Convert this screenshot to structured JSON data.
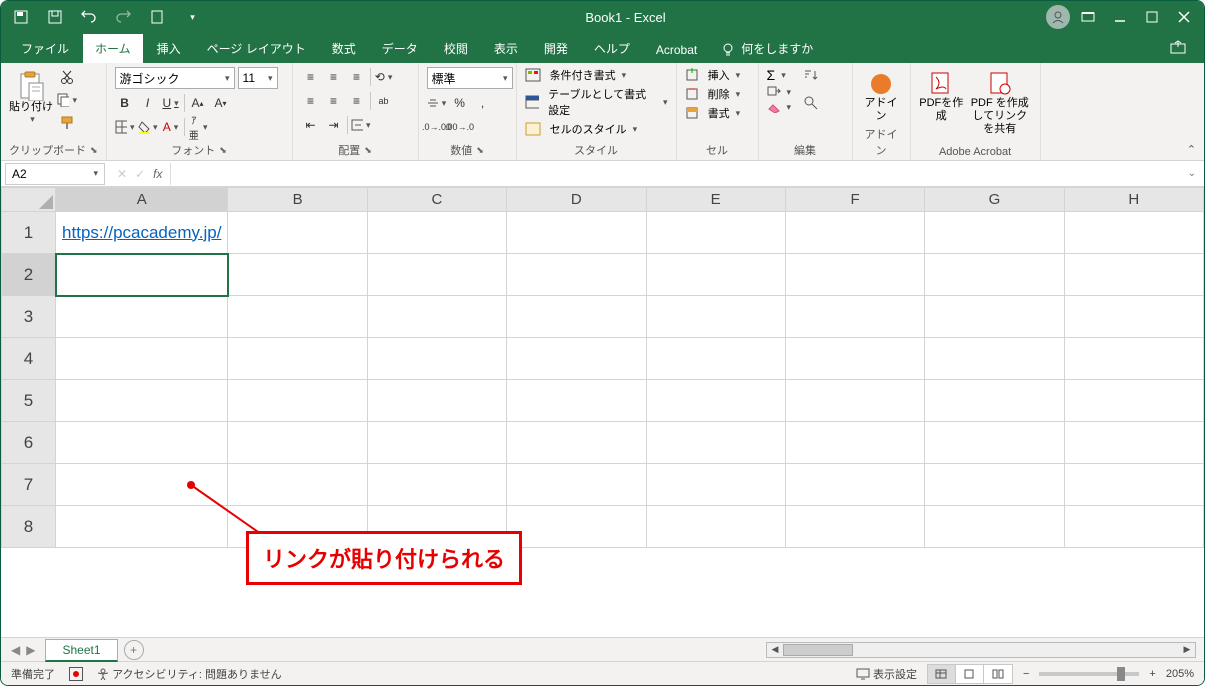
{
  "app": {
    "title": "Book1  -  Excel",
    "app_name": "Excel"
  },
  "qat": {
    "save": "floppy",
    "undo": "undo",
    "redo": "redo",
    "touch": "touch"
  },
  "tabs": {
    "file": "ファイル",
    "home": "ホーム",
    "insert": "挿入",
    "page_layout": "ページ レイアウト",
    "formulas": "数式",
    "data": "データ",
    "review": "校閲",
    "view": "表示",
    "developer": "開発",
    "help": "ヘルプ",
    "acrobat": "Acrobat",
    "tell_me": "何をしますか"
  },
  "ribbon": {
    "clipboard": {
      "label": "クリップボード",
      "paste": "貼り付け"
    },
    "font": {
      "label": "フォント",
      "name": "游ゴシック",
      "size": "11",
      "bold": "B",
      "italic": "I",
      "underline": "U"
    },
    "alignment": {
      "label": "配置",
      "wrap": "ab"
    },
    "number": {
      "label": "数値",
      "format": "標準",
      "percent": "%",
      "comma": ","
    },
    "styles": {
      "label": "スタイル",
      "cond": "条件付き書式",
      "table_fmt": "テーブルとして書式設定",
      "cell_styles": "セルのスタイル"
    },
    "cells": {
      "label": "セル",
      "insert": "挿入",
      "delete": "削除",
      "format": "書式"
    },
    "editing": {
      "label": "編集",
      "sum": "Σ",
      "fill": "fill",
      "clear": "clear"
    },
    "addins": {
      "label": "アドイン",
      "btn": "アドイン"
    },
    "acrobat": {
      "label": "Adobe Acrobat",
      "create": "PDFを作成",
      "share": "PDF を作成してリンクを共有"
    }
  },
  "formula_bar": {
    "cell_ref": "A2",
    "cancel": "✕",
    "confirm": "✓",
    "fx": "fx",
    "formula": ""
  },
  "grid": {
    "columns": [
      "A",
      "B",
      "C",
      "D",
      "E",
      "F",
      "G",
      "H"
    ],
    "rows": [
      "1",
      "2",
      "3",
      "4",
      "5",
      "6",
      "7",
      "8"
    ],
    "active_cell": "A2",
    "active_col": "A",
    "active_row": "2",
    "cells": {
      "A1": {
        "text": "https://pcacademy.jp/",
        "is_link": true
      }
    }
  },
  "callout": {
    "text": "リンクが貼り付けられる"
  },
  "sheet_tabs": {
    "sheets": [
      "Sheet1"
    ],
    "active": "Sheet1"
  },
  "statusbar": {
    "ready": "準備完了",
    "accessibility": "アクセシビリティ: 問題ありません",
    "display_settings": "表示設定",
    "zoom": "205%"
  }
}
